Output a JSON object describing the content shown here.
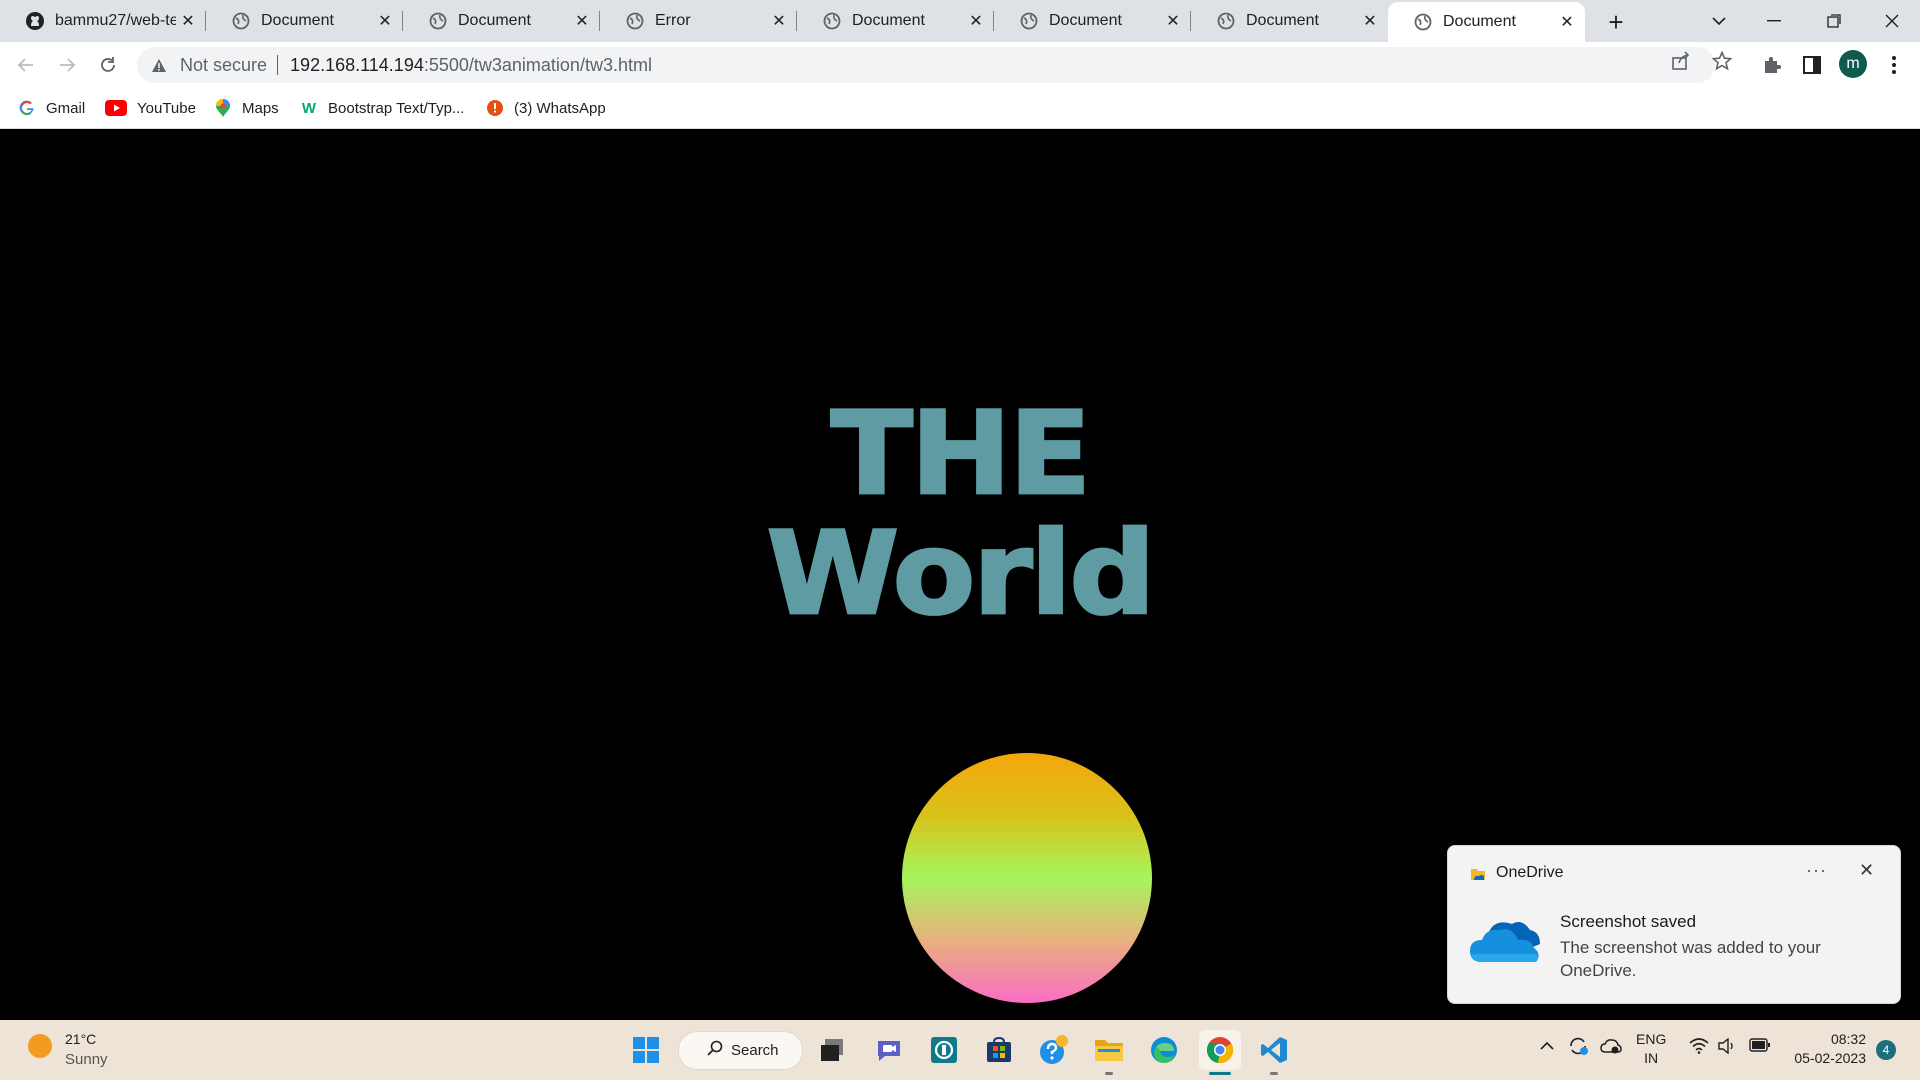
{
  "browser": {
    "tabs": [
      {
        "title": "bammu27/web-te",
        "favicon": "github-icon",
        "active": false
      },
      {
        "title": "Document",
        "favicon": "globe-icon",
        "active": false
      },
      {
        "title": "Document",
        "favicon": "globe-icon",
        "active": false
      },
      {
        "title": "Error",
        "favicon": "globe-icon",
        "active": false
      },
      {
        "title": "Document",
        "favicon": "globe-icon",
        "active": false
      },
      {
        "title": "Document",
        "favicon": "globe-icon",
        "active": false
      },
      {
        "title": "Document",
        "favicon": "globe-icon",
        "active": false
      },
      {
        "title": "Document",
        "favicon": "globe-icon",
        "active": true
      }
    ],
    "security_label": "Not secure",
    "url_host": "192.168.114.194",
    "url_rest": ":5500/tw3animation/tw3.html",
    "profile_initial": "m",
    "bookmarks": [
      {
        "label": "Gmail",
        "icon": "google-icon"
      },
      {
        "label": "YouTube",
        "icon": "youtube-icon"
      },
      {
        "label": "Maps",
        "icon": "maps-icon"
      },
      {
        "label": "Bootstrap Text/Typ...",
        "icon": "w3schools-icon"
      },
      {
        "label": "(3) WhatsApp",
        "icon": "whatsapp-icon"
      }
    ]
  },
  "page": {
    "heading_line1": "THE",
    "heading_line2": "World",
    "heading_color": "#5e9ba2",
    "ball_gradient": [
      "#f5a60b",
      "#a6f55c",
      "#fb6ec7"
    ]
  },
  "toast": {
    "app_name": "OneDrive",
    "more": "···",
    "heading": "Screenshot saved",
    "body": "The screenshot was added to your OneDrive."
  },
  "taskbar": {
    "weather_temp": "21°C",
    "weather_desc": "Sunny",
    "search_label": "Search",
    "lang_line1": "ENG",
    "lang_line2": "IN",
    "time": "08:32",
    "date": "05-02-2023",
    "notification_count": "4"
  }
}
